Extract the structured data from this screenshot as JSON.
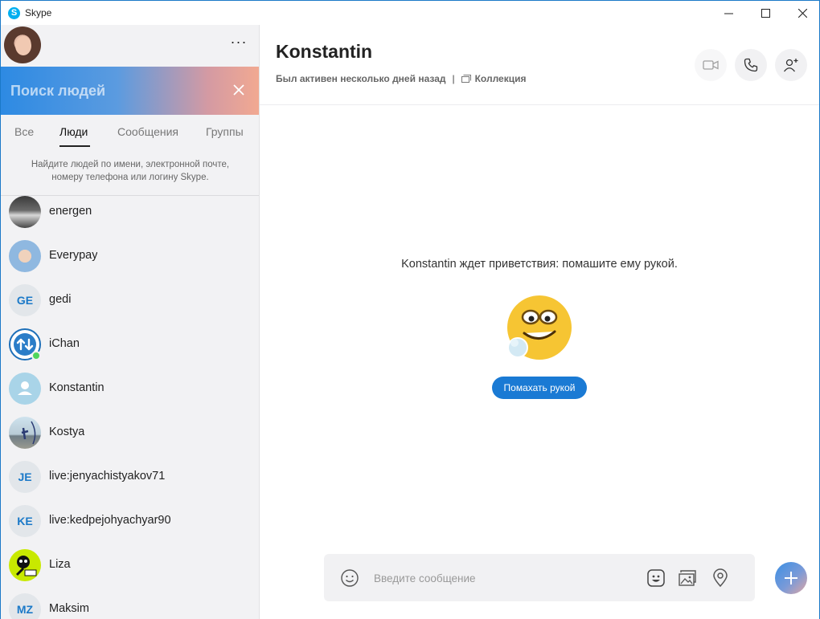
{
  "window": {
    "title": "Skype",
    "minimize_glyph": "—",
    "close_glyph": "✕"
  },
  "colors": {
    "accent": "#1a7ad4",
    "online": "#4fd65d",
    "initials": "#1b79c8"
  },
  "sidebar": {
    "more_label": "···",
    "search": {
      "placeholder": "Поиск людей"
    },
    "tabs": [
      {
        "label": "Все"
      },
      {
        "label": "Люди",
        "active": true
      },
      {
        "label": "Сообщения"
      },
      {
        "label": "Группы"
      }
    ],
    "hint": "Найдите людей по имени, электронной почте, номеру телефона или логину Skype.",
    "contacts": [
      {
        "name": "energen",
        "avatar": "photo"
      },
      {
        "name": "Everypay",
        "avatar": "photo"
      },
      {
        "name": "gedi",
        "initials": "GE"
      },
      {
        "name": "iChan",
        "avatar": "icon",
        "online": true
      },
      {
        "name": "Konstantin",
        "avatar": "default-user"
      },
      {
        "name": "Kostya",
        "avatar": "photo"
      },
      {
        "name": "live:jenyachistyakov71",
        "initials": "JE"
      },
      {
        "name": "live:kedpejohyachyar90",
        "initials": "KE"
      },
      {
        "name": "Liza",
        "avatar": "photo"
      },
      {
        "name": "Maksim",
        "initials": "MZ"
      }
    ]
  },
  "chat": {
    "title": "Konstantin",
    "status": "Был активен несколько дней назад",
    "separator": "|",
    "gallery_label": "Коллекция",
    "wave_text": "Konstantin ждет приветствия: помашите ему рукой.",
    "wave_button": "Помахать рукой",
    "composer_placeholder": "Введите сообщение"
  },
  "icons": {
    "video": "video-camera-icon",
    "call": "phone-icon",
    "add_user": "add-user-icon",
    "emoji": "smiley-icon",
    "sticker": "sticker-icon",
    "media": "gallery-icon",
    "location": "location-pin-icon",
    "plus": "plus-icon"
  }
}
